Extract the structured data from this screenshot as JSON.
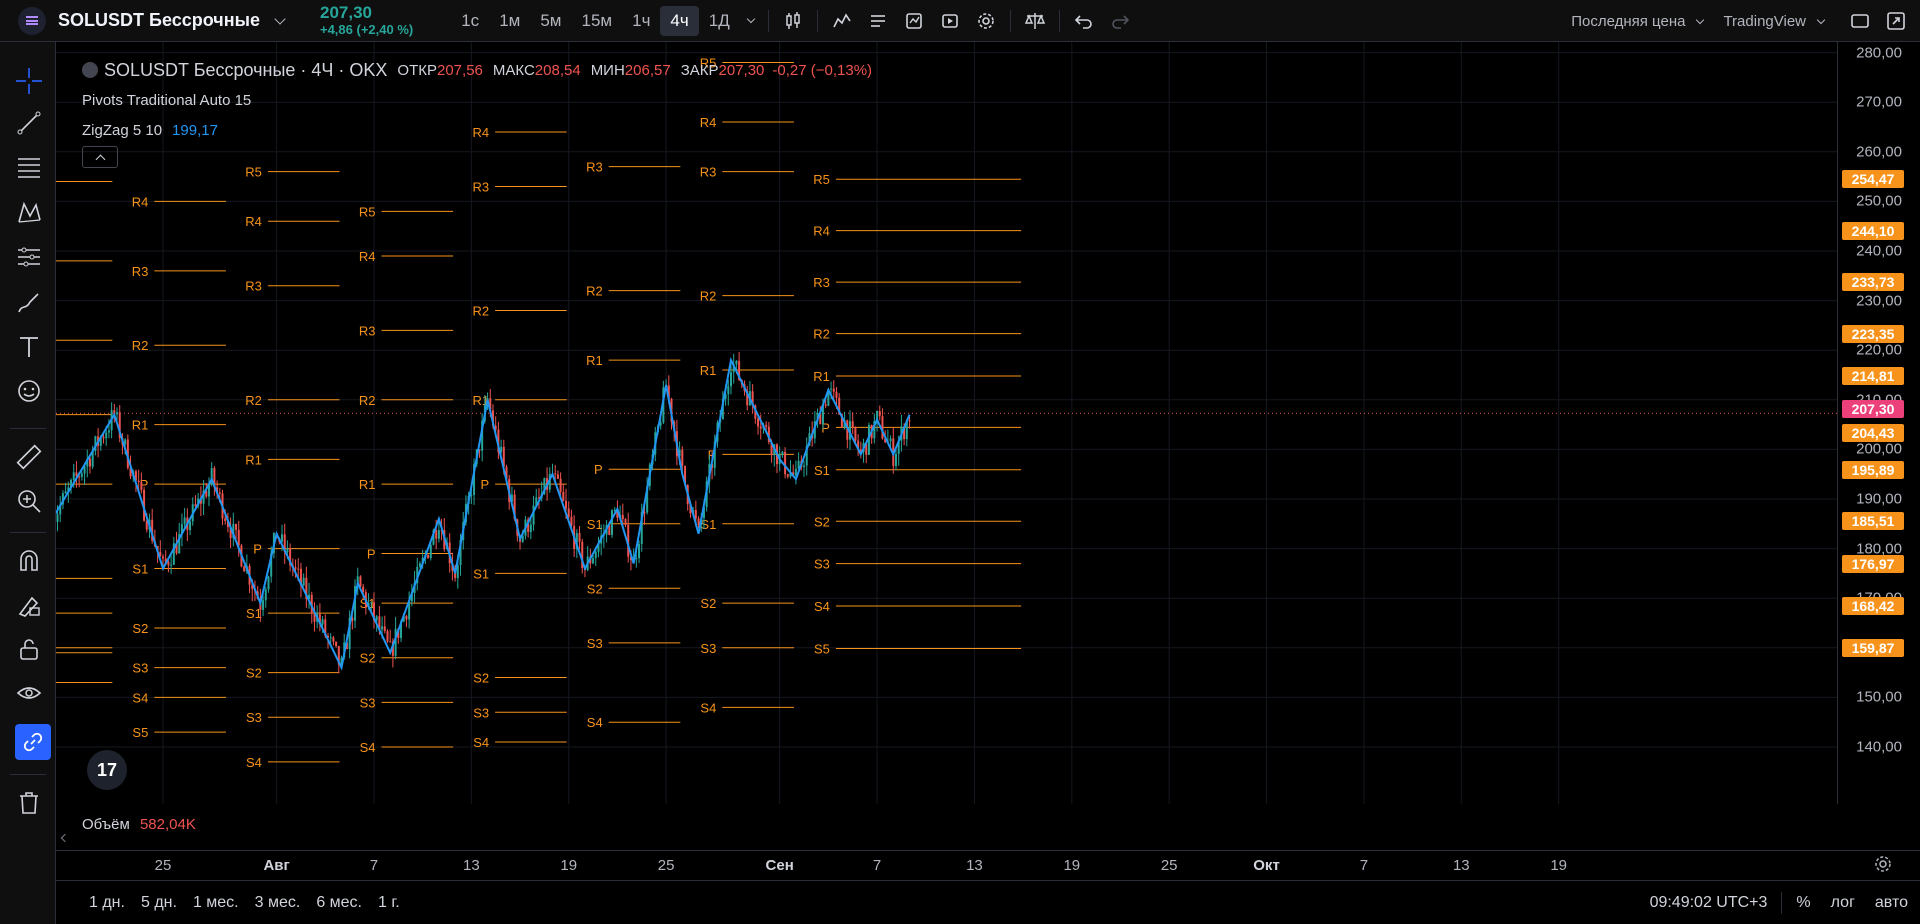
{
  "header": {
    "symbol": "SOLUSDT Бессрочные",
    "price": "207,30",
    "change": "+4,86 (+2,40 %)",
    "intervals": [
      "1с",
      "1м",
      "5м",
      "15м",
      "1ч",
      "4ч",
      "1Д"
    ],
    "active_interval": "4ч",
    "price_type": "Последняя цена",
    "layout_name": "TradingView"
  },
  "legend": {
    "title": "SOLUSDT Бессрочные · 4Ч · OKX",
    "open_label": "ОТКР",
    "open": "207,56",
    "high_label": "МАКС",
    "high": "208,54",
    "low_label": "МИН",
    "low": "206,57",
    "close_label": "ЗАКР",
    "close": "207,30",
    "change": "-0,27 (−0,13%)",
    "indicator_pivots": "Pivots Traditional Auto 15",
    "indicator_zigzag": "ZigZag 5 10",
    "zigzag_value": "199,17"
  },
  "volume": {
    "label": "Объём",
    "value": "582,04K"
  },
  "price_axis": {
    "ticks": [
      "280,00",
      "270,00",
      "260,00",
      "250,00",
      "240,00",
      "230,00",
      "220,00",
      "210,00",
      "200,00",
      "190,00",
      "180,00",
      "170,00",
      "150,00",
      "140,00"
    ],
    "tags": [
      "254,47",
      "244,10",
      "233,73",
      "223,35",
      "214,81",
      "207,30",
      "204,43",
      "195,89",
      "185,51",
      "176,97",
      "168,42",
      "159,87"
    ]
  },
  "time_axis": {
    "labels": [
      "25",
      "Авг",
      "7",
      "13",
      "19",
      "25",
      "Сен",
      "7",
      "13",
      "19",
      "25",
      "Окт",
      "7",
      "13",
      "19"
    ]
  },
  "bottom": {
    "ranges": [
      "1 дн.",
      "5 дн.",
      "1 мес.",
      "3 мес.",
      "6 мес.",
      "1 г."
    ],
    "clock": "09:49:02 UTC+3",
    "percent": "%",
    "log": "лог",
    "auto": "авто"
  },
  "colors": {
    "up": "#26a69a",
    "down": "#ef5350",
    "pivot": "#f7931a",
    "zigzag": "#2196f3",
    "accent": "#2962ff"
  },
  "chart_data": {
    "type": "candlestick",
    "symbol": "SOLUSDT Бессрочные",
    "timeframe": "4Ч",
    "ylim": [
      134,
      283
    ],
    "pivot_labels": [
      "R5",
      "R4",
      "R3",
      "R2",
      "R1",
      "P",
      "S1",
      "S2",
      "S3",
      "S4",
      "S5"
    ],
    "periods": [
      {
        "levels": {
          "R5": 254,
          "R3": 238,
          "R2": 222,
          "R1": 207,
          "P": 193,
          "S1": 174,
          "S2": 167,
          "S3": 160,
          "S4": 159,
          "S5": 153
        }
      },
      {
        "levels": {
          "R4": 250,
          "R3": 236,
          "R2": 221,
          "R1": 205,
          "P": 193,
          "S1": 176,
          "S2": 164,
          "S3": 156,
          "S4": 150,
          "S5": 143
        }
      },
      {
        "levels": {
          "R5": 256,
          "R4": 246,
          "R3": 233,
          "R2": 210,
          "R1": 198,
          "P": 180,
          "S1": 167,
          "S2": 155,
          "S3": 146,
          "S4": 137
        }
      },
      {
        "levels": {
          "R5": 248,
          "R4": 239,
          "R3": 224,
          "R2": 210,
          "R1": 193,
          "P": 179,
          "S1": 169,
          "S2": 158,
          "S3": 149,
          "S4": 140
        }
      },
      {
        "levels": {
          "R4": 264,
          "R3": 253,
          "R2": 228,
          "R1": 210,
          "P": 193,
          "S1": 175,
          "S2": 154,
          "S3": 147,
          "S4": 141
        }
      },
      {
        "levels": {
          "R3": 257,
          "R2": 232,
          "R1": 218,
          "P": 196,
          "S1": 185,
          "S2": 172,
          "S3": 161,
          "S4": 145
        }
      },
      {
        "levels": {
          "R5": 278,
          "R4": 266,
          "R3": 256,
          "R2": 231,
          "R1": 216,
          "P": 199,
          "S1": 185,
          "S2": 169,
          "S3": 160,
          "S4": 148
        }
      },
      {
        "levels": {
          "R5": 254.47,
          "R4": 244.1,
          "R3": 233.73,
          "R2": 223.35,
          "R1": 214.81,
          "P": 204.43,
          "S1": 195.89,
          "S2": 185.51,
          "S3": 176.97,
          "S4": 168.42,
          "S5": 159.87
        }
      }
    ],
    "zigzag": [
      {
        "x": "Jul 18",
        "y": 185
      },
      {
        "x": "Jul 22",
        "y": 207
      },
      {
        "x": "Jul 25",
        "y": 176
      },
      {
        "x": "Jul 28",
        "y": 194
      },
      {
        "x": "Jul 31",
        "y": 169
      },
      {
        "x": "Aug 1",
        "y": 183
      },
      {
        "x": "Aug 5",
        "y": 156
      },
      {
        "x": "Aug 6",
        "y": 173
      },
      {
        "x": "Aug 8",
        "y": 159
      },
      {
        "x": "Aug 11",
        "y": 186
      },
      {
        "x": "Aug 12",
        "y": 175
      },
      {
        "x": "Aug 14",
        "y": 210
      },
      {
        "x": "Aug 16",
        "y": 182
      },
      {
        "x": "Aug 18",
        "y": 195
      },
      {
        "x": "Aug 20",
        "y": 176
      },
      {
        "x": "Aug 22",
        "y": 188
      },
      {
        "x": "Aug 23",
        "y": 177
      },
      {
        "x": "Aug 25",
        "y": 213
      },
      {
        "x": "Aug 26",
        "y": 195
      },
      {
        "x": "Aug 27",
        "y": 183
      },
      {
        "x": "Aug 29",
        "y": 218
      },
      {
        "x": "Sep 1",
        "y": 198
      },
      {
        "x": "Sep 2",
        "y": 194
      },
      {
        "x": "Sep 4",
        "y": 212
      },
      {
        "x": "Sep 6",
        "y": 199
      },
      {
        "x": "Sep 7",
        "y": 206
      },
      {
        "x": "Sep 8",
        "y": 199
      },
      {
        "x": "Sep 9",
        "y": 207
      }
    ],
    "last_price": 207.3
  }
}
